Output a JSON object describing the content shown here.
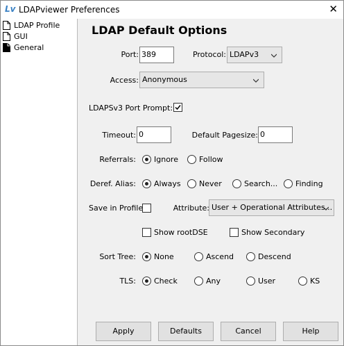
{
  "window": {
    "title": "LDAPviewer Preferences",
    "app_icon": "Lv",
    "close_glyph": "✕"
  },
  "sidebar": {
    "items": [
      {
        "label": "LDAP Profile",
        "icon": "document-icon"
      },
      {
        "label": "GUI",
        "icon": "document-icon"
      },
      {
        "label": "General",
        "icon": "document-icon"
      }
    ]
  },
  "main": {
    "heading": "LDAP Default Options",
    "port": {
      "label": "Port:",
      "value": "389"
    },
    "protocol": {
      "label": "Protocol:",
      "value": "LDAPv3"
    },
    "access": {
      "label": "Access:",
      "value": "Anonymous"
    },
    "ldapsv3_prompt": {
      "label": "LDAPSv3 Port Prompt:",
      "checked": true
    },
    "timeout": {
      "label": "Timeout:",
      "value": "0"
    },
    "pagesize": {
      "label": "Default Pagesize:",
      "value": "0"
    },
    "referrals": {
      "label": "Referrals:",
      "options": [
        "Ignore",
        "Follow"
      ],
      "selected": "Ignore"
    },
    "deref": {
      "label": "Deref. Alias:",
      "options": [
        "Always",
        "Never",
        "Search...",
        "Finding"
      ],
      "selected": "Always"
    },
    "save_profile": {
      "label": "Save in Profile",
      "checked": false
    },
    "attribute": {
      "label": "Attribute:",
      "value": "User + Operational Attributes..."
    },
    "show_rootdse": {
      "label": "Show rootDSE",
      "checked": false
    },
    "show_secondary": {
      "label": "Show Secondary",
      "checked": false
    },
    "sort_tree": {
      "label": "Sort Tree:",
      "options": [
        "None",
        "Ascend",
        "Descend"
      ],
      "selected": "None"
    },
    "tls": {
      "label": "TLS:",
      "options": [
        "Check",
        "Any",
        "User",
        "KS"
      ],
      "selected": "Check"
    }
  },
  "buttons": {
    "apply": "Apply",
    "defaults": "Defaults",
    "cancel": "Cancel",
    "help": "Help"
  }
}
